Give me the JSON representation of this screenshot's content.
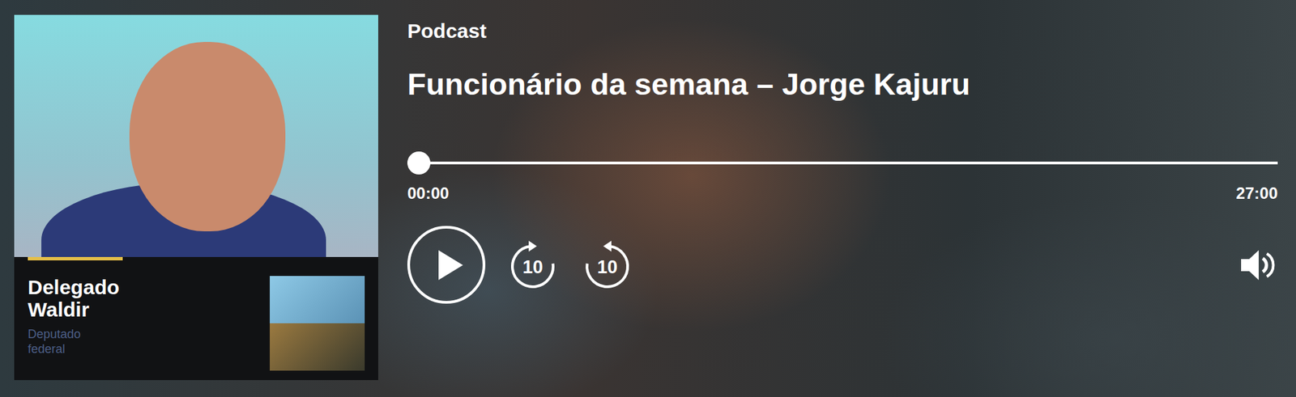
{
  "podcast_label": "Podcast",
  "title": "Funcionário da semana – Jorge Kajuru",
  "player": {
    "level": 0,
    "elapsed": "00:00",
    "duration": "27:00",
    "playing": false,
    "skip_back": "10",
    "skip_forward": "10"
  },
  "card": {
    "name": "Delegado Waldir",
    "role": "Deputado federal"
  }
}
